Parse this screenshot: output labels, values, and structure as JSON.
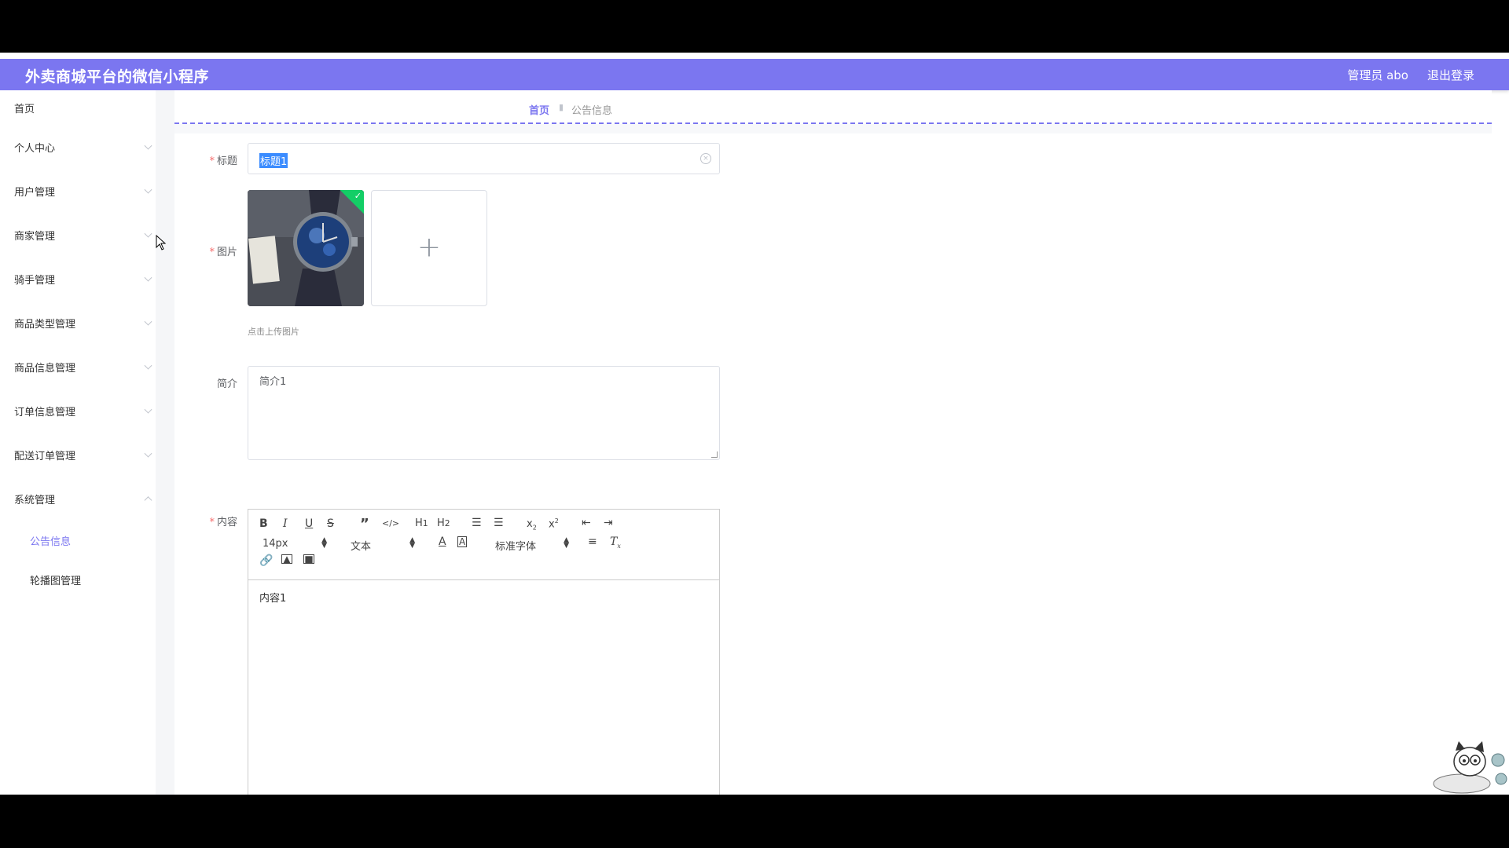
{
  "header": {
    "app_title": "外卖商城平台的微信小程序",
    "user_label": "管理员 abo",
    "logout_label": "退出登录"
  },
  "sidebar": {
    "items": [
      {
        "label": "首页"
      },
      {
        "label": "个人中心"
      },
      {
        "label": "用户管理"
      },
      {
        "label": "商家管理"
      },
      {
        "label": "骑手管理"
      },
      {
        "label": "商品类型管理"
      },
      {
        "label": "商品信息管理"
      },
      {
        "label": "订单信息管理"
      },
      {
        "label": "配送订单管理"
      },
      {
        "label": "系统管理"
      }
    ],
    "sub_items": [
      {
        "label": "公告信息",
        "active": true
      },
      {
        "label": "轮播图管理",
        "active": false
      }
    ]
  },
  "breadcrumb": {
    "home": "首页",
    "current": "公告信息"
  },
  "form": {
    "title_label": "标题",
    "title_value": "标题1",
    "image_label": "图片",
    "upload_tip": "点击上传图片",
    "summary_label": "简介",
    "summary_value": "简介1",
    "content_label": "内容",
    "content_value": "内容1"
  },
  "editor": {
    "font_size": "14px",
    "paragraph": "文本",
    "font_family": "标准字体"
  },
  "colors": {
    "accent": "#7b76f0",
    "required": "#f56c6c",
    "success": "#13ce66"
  }
}
